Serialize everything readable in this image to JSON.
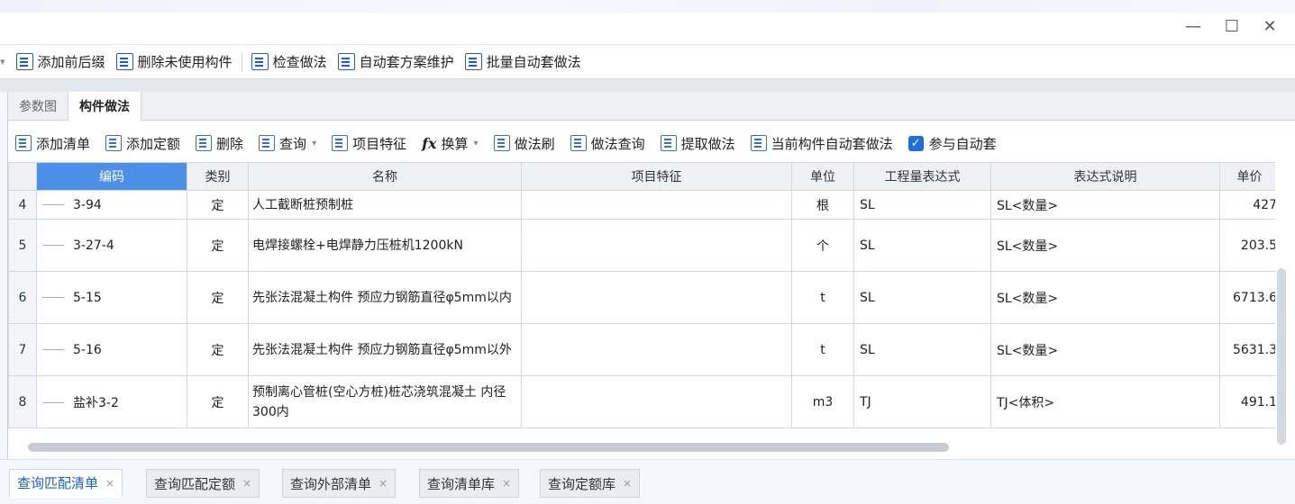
{
  "window": {
    "min_glyph": "—",
    "max_glyph": "☐",
    "close_glyph": "✕"
  },
  "toolbar1": {
    "lead": "·",
    "items": [
      {
        "label": "添加前后缀",
        "icon": "list-icon"
      },
      {
        "label": "删除未使用构件",
        "icon": "delete-list-icon"
      },
      {
        "label": "检查做法",
        "icon": "check-icon"
      },
      {
        "label": "自动套方案维护",
        "icon": "settings-list-icon"
      },
      {
        "label": "批量自动套做法",
        "icon": "batch-icon"
      }
    ]
  },
  "tabs": [
    {
      "label": "参数图",
      "active": false
    },
    {
      "label": "构件做法",
      "active": true
    }
  ],
  "toolbar2": {
    "items": [
      {
        "label": "添加清单",
        "icon": "add-list-icon"
      },
      {
        "label": "添加定额",
        "icon": "add-quota-icon"
      },
      {
        "label": "删除",
        "icon": "trash-icon"
      },
      {
        "label": "查询",
        "icon": "query-icon",
        "dropdown": true
      },
      {
        "label": "项目特征",
        "icon": "feature-icon"
      },
      {
        "label": "换算",
        "icon": "fx-icon",
        "dropdown": true
      },
      {
        "label": "做法刷",
        "icon": "brush-icon"
      },
      {
        "label": "做法查询",
        "icon": "method-query-icon"
      },
      {
        "label": "提取做法",
        "icon": "extract-icon"
      },
      {
        "label": "当前构件自动套做法",
        "icon": "auto-icon"
      }
    ],
    "checkbox_label": "参与自动套",
    "checkbox_checked": true
  },
  "table": {
    "headers": [
      "编码",
      "类别",
      "名称",
      "项目特征",
      "单位",
      "工程量表达式",
      "表达式说明",
      "单价"
    ],
    "rows": [
      {
        "num": "4",
        "code": "3-94",
        "type": "定",
        "name": "人工截断桩预制桩",
        "feature": "",
        "unit": "根",
        "expr": "SL",
        "desc": "SL<数量>",
        "price": "427"
      },
      {
        "num": "5",
        "code": "3-27-4",
        "type": "定",
        "name": "电焊接螺栓+电焊静力压桩机1200kN",
        "feature": "",
        "unit": "个",
        "expr": "SL",
        "desc": "SL<数量>",
        "price": "203.5"
      },
      {
        "num": "6",
        "code": "5-15",
        "type": "定",
        "name": "先张法混凝土构件 预应力钢筋直径φ5mm以内",
        "feature": "",
        "unit": "t",
        "expr": "SL",
        "desc": "SL<数量>",
        "price": "6713.6"
      },
      {
        "num": "7",
        "code": "5-16",
        "type": "定",
        "name": "先张法混凝土构件 预应力钢筋直径φ5mm以外",
        "feature": "",
        "unit": "t",
        "expr": "SL",
        "desc": "SL<数量>",
        "price": "5631.3"
      },
      {
        "num": "8",
        "code": "盐补3-2",
        "type": "定",
        "name": "预制离心管桩(空心方桩)桩芯浇筑混凝土 内径300内",
        "feature": "",
        "unit": "m3",
        "expr": "TJ",
        "desc": "TJ<体积>",
        "price": "491.1"
      }
    ]
  },
  "bottom_tabs": [
    {
      "label": "查询匹配清单",
      "active": true
    },
    {
      "label": "查询匹配定额",
      "active": false
    },
    {
      "label": "查询外部清单",
      "active": false
    },
    {
      "label": "查询清单库",
      "active": false
    },
    {
      "label": "查询定额库",
      "active": false
    }
  ],
  "close_glyph": "×",
  "check_glyph": "✓",
  "caret_glyph": "▾",
  "fx_glyph": "fx"
}
